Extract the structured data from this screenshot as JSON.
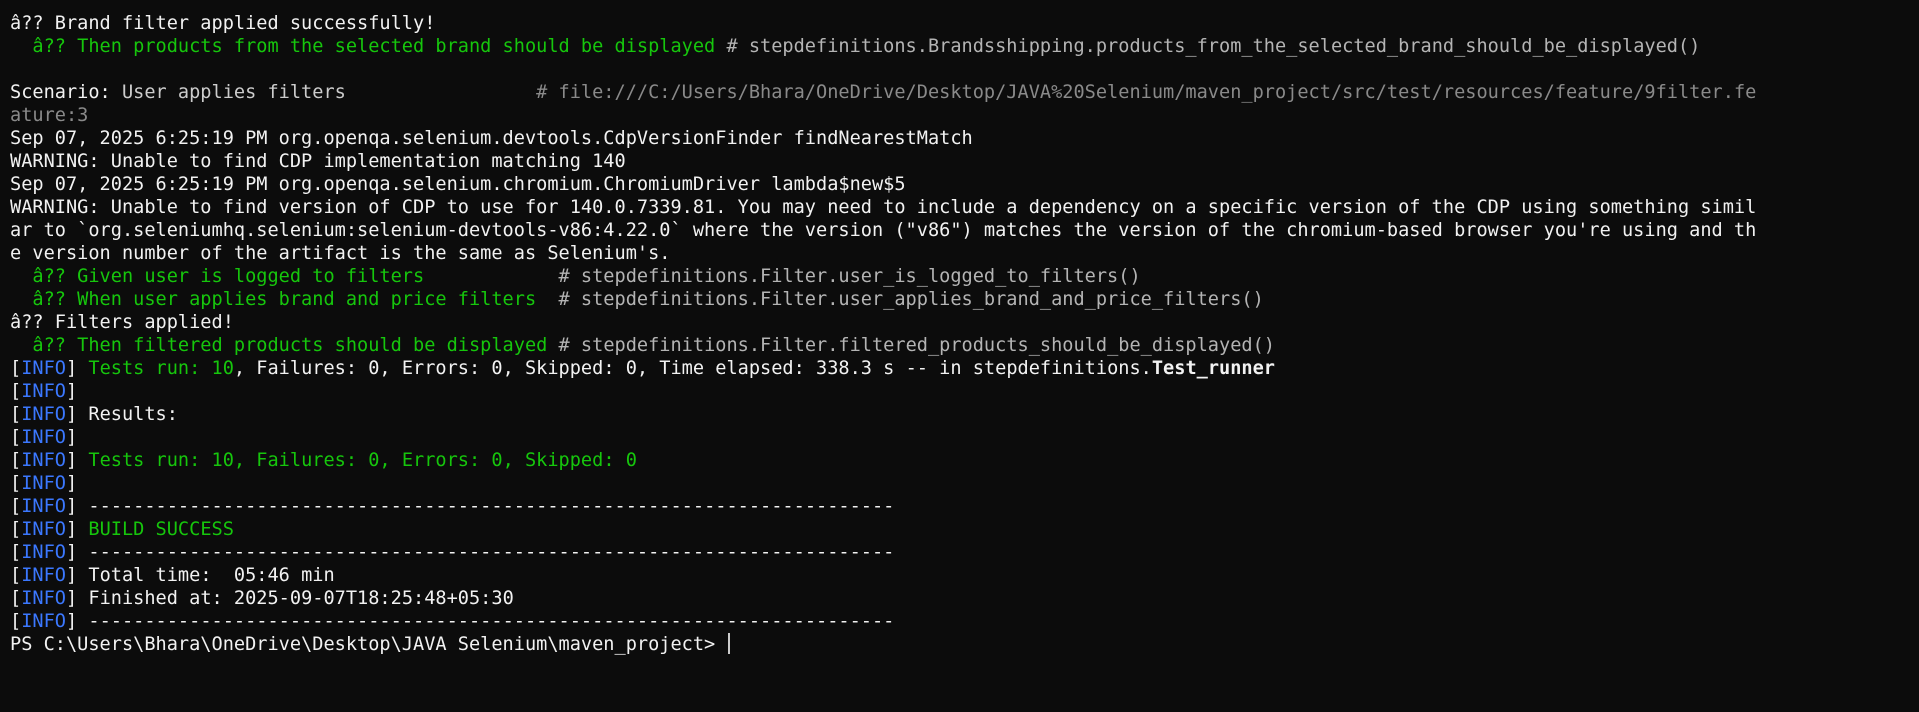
{
  "lines": {
    "l1": "â?? Brand filter applied successfully!",
    "l2_step": "  â?? Then products from the selected brand should be displayed",
    "l2_comment": " # stepdefinitions.Brandsshipping.products_from_the_selected_brand_should_be_displayed()",
    "l4_keyword": "Scenario:",
    "l4_title": " User applies filters                 ",
    "l4_comment": "# file:///C:/Users/Bhara/OneDrive/Desktop/JAVA%20Selenium/maven_project/src/test/resources/feature/9filter.fe",
    "l5": "ature:3",
    "l6": "Sep 07, 2025 6:25:19 PM org.openqa.selenium.devtools.CdpVersionFinder findNearestMatch",
    "l7": "WARNING: Unable to find CDP implementation matching 140",
    "l8": "Sep 07, 2025 6:25:19 PM org.openqa.selenium.chromium.ChromiumDriver lambda$new$5",
    "l9": "WARNING: Unable to find version of CDP to use for 140.0.7339.81. You may need to include a dependency on a specific version of the CDP using something simil",
    "l10": "ar to `org.seleniumhq.selenium:selenium-devtools-v86:4.22.0` where the version (\"v86\") matches the version of the chromium-based browser you're using and th",
    "l11": "e version number of the artifact is the same as Selenium's.",
    "l12_step": "  â?? Given user is logged to filters            ",
    "l12_comment": "# stepdefinitions.Filter.user_is_logged_to_filters()",
    "l13_step": "  â?? When user applies brand and price filters  ",
    "l13_comment": "# stepdefinitions.Filter.user_applies_brand_and_price_filters()",
    "l14": "â?? Filters applied!",
    "l15_step": "  â?? Then filtered products should be displayed",
    "l15_comment": " # stepdefinitions.Filter.filtered_products_should_be_displayed()"
  },
  "info": {
    "bracket_open": "[",
    "tag": "INFO",
    "bracket_close": "] ",
    "tests_run_label": "Tests run: ",
    "tests_run_value": "10",
    "summary_rest": ", Failures: 0, Errors: 0, Skipped: 0, Time elapsed: 338.3 s -- in stepdefinitions.",
    "runner": "Test_runner",
    "results": "Results:",
    "totals": "Tests run: 10, Failures: 0, Errors: 0, Skipped: 0",
    "separator": "------------------------------------------------------------------------",
    "build_success": "BUILD SUCCESS",
    "total_time": "Total time:  05:46 min",
    "finished_at": "Finished at: 2025-09-07T18:25:48+05:30"
  },
  "prompt": "PS C:\\Users\\Bhara\\OneDrive\\Desktop\\JAVA Selenium\\maven_project> "
}
